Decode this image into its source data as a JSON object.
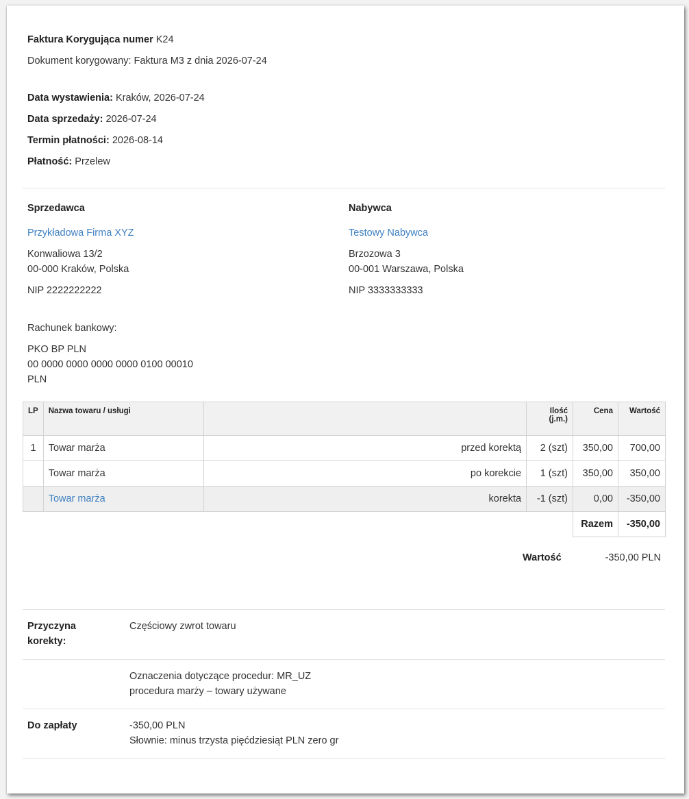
{
  "header": {
    "title_label": "Faktura Korygująca numer",
    "title_number": "K24",
    "corrected_doc": "Dokument korygowany: Faktura M3 z dnia 2026-07-24"
  },
  "dates": {
    "issue_label": "Data wystawienia:",
    "issue_value": "Kraków, 2026-07-24",
    "sale_label": "Data sprzedaży:",
    "sale_value": "2026-07-24",
    "due_label": "Termin płatności:",
    "due_value": "2026-08-14",
    "payment_label": "Płatność:",
    "payment_value": "Przelew"
  },
  "seller": {
    "heading": "Sprzedawca",
    "name": "Przykładowa Firma XYZ",
    "street": "Konwaliowa 13/2",
    "city": "00-000 Kraków, Polska",
    "nip": "NIP 2222222222"
  },
  "buyer": {
    "heading": "Nabywca",
    "name": "Testowy Nabywca",
    "street": "Brzozowa 3",
    "city": "00-001 Warszawa, Polska",
    "nip": "NIP 3333333333"
  },
  "bank": {
    "label": "Rachunek bankowy:",
    "bank_name": "PKO BP PLN",
    "account": "00 0000 0000 0000 0000 0100 00010",
    "currency": "PLN"
  },
  "table": {
    "headers": {
      "lp": "LP",
      "name": "Nazwa towaru / usługi",
      "qty_line1": "Ilość",
      "qty_line2": "(j.m.)",
      "price": "Cena",
      "value": "Wartość"
    },
    "rows": [
      {
        "lp": "1",
        "name": "Towar marża",
        "note": "przed korektą",
        "qty": "2 (szt)",
        "price": "350,00",
        "value": "700,00"
      },
      {
        "lp": "",
        "name": "Towar marża",
        "note": "po korekcie",
        "qty": "1 (szt)",
        "price": "350,00",
        "value": "350,00"
      },
      {
        "lp": "",
        "name": "Towar marża",
        "note": "korekta",
        "qty": "-1 (szt)",
        "price": "0,00",
        "value": "-350,00"
      }
    ],
    "sum_label": "Razem",
    "sum_value": "-350,00"
  },
  "total": {
    "label": "Wartość",
    "value": "-350,00 PLN"
  },
  "footer": {
    "reason_label_1": "Przyczyna",
    "reason_label_2": "korekty:",
    "reason_value": "Częściowy zwrot towaru",
    "procedure_line1": "Oznaczenia dotyczące procedur: MR_UZ",
    "procedure_line2": "procedura marży – towary używane",
    "pay_label": "Do zapłaty",
    "pay_value": "-350,00 PLN",
    "pay_words": "Słownie: minus trzysta pięćdziesiąt PLN zero gr"
  },
  "colors": {
    "link": "#3d7fc1",
    "text": "#333333",
    "table_header_bg": "#f1f1f1",
    "row_highlight_bg": "#efefef"
  }
}
